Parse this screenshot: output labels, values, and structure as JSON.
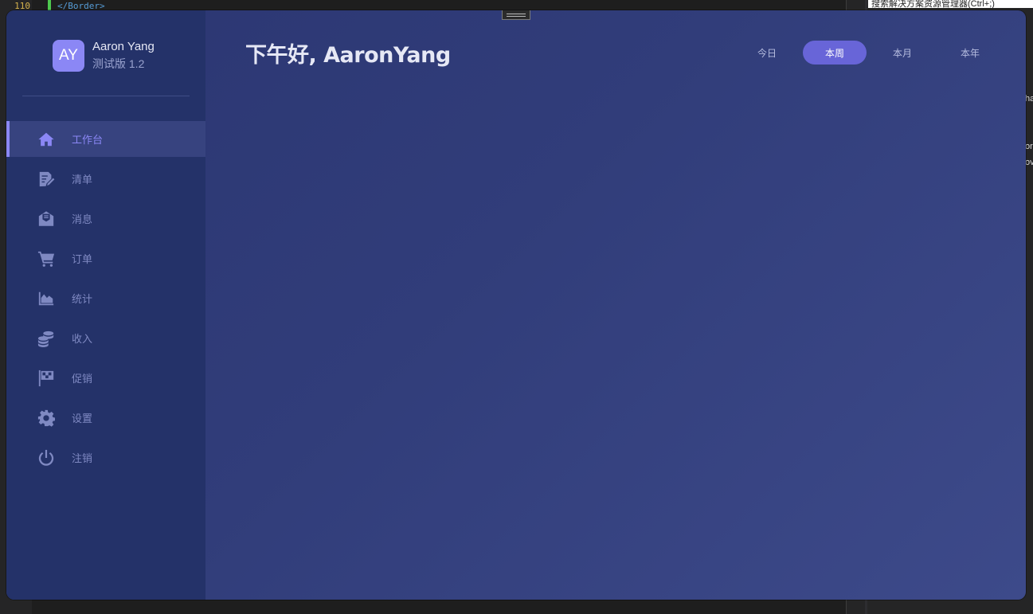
{
  "ide": {
    "line_number": "110",
    "code_text": "</Border>",
    "right_panel_search": "搜索解决方案资源管理器(Ctrl+;)",
    "edge_fragments": [
      "ha",
      "or",
      "ov"
    ]
  },
  "profile": {
    "avatar_initials": "AY",
    "name": "Aaron Yang",
    "version": "测试版 1.2"
  },
  "nav": {
    "items": [
      {
        "label": "工作台",
        "icon": "home-icon",
        "active": true
      },
      {
        "label": "清单",
        "icon": "edit-list-icon",
        "active": false
      },
      {
        "label": "消息",
        "icon": "envelope-open-icon",
        "active": false
      },
      {
        "label": "订单",
        "icon": "shopping-cart-icon",
        "active": false
      },
      {
        "label": "统计",
        "icon": "area-chart-icon",
        "active": false
      },
      {
        "label": "收入",
        "icon": "coins-icon",
        "active": false
      },
      {
        "label": "促销",
        "icon": "checkered-flag-icon",
        "active": false
      },
      {
        "label": "设置",
        "icon": "gear-icon",
        "active": false
      },
      {
        "label": "注销",
        "icon": "power-icon",
        "active": false
      }
    ]
  },
  "main": {
    "greeting": "下午好, AaronYang",
    "period_tabs": [
      {
        "label": "今日",
        "active": false
      },
      {
        "label": "本周",
        "active": true
      },
      {
        "label": "本月",
        "active": false
      },
      {
        "label": "本年",
        "active": false
      }
    ]
  },
  "colors": {
    "accent": "#8b87f5",
    "active_tab": "#6865d8",
    "sidebar": "#243269",
    "main_bg": "#313d7a"
  }
}
